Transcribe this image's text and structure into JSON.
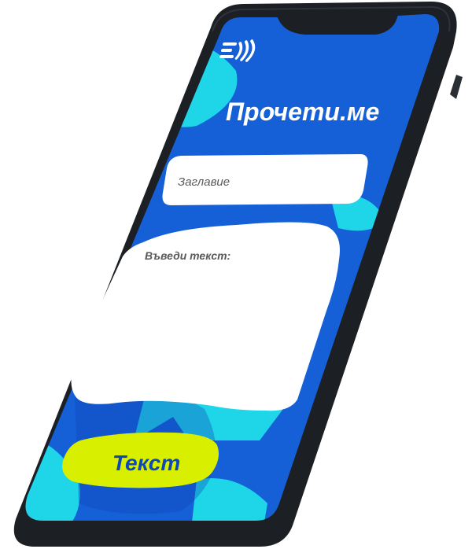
{
  "app": {
    "title": "Прочети.ме"
  },
  "title_field": {
    "placeholder": "Заглавие"
  },
  "text_field": {
    "placeholder": "Въведи текст:"
  },
  "action_button": {
    "label": "Текст"
  },
  "colors": {
    "device_frame": "#1c1f24",
    "screen_bg": "#1560d6",
    "accent_cyan": "#1fd6e8",
    "button_lime": "#d8f000",
    "field_bg": "#ffffff",
    "field_text": "#595959",
    "button_text": "#1046b8"
  },
  "icons": {
    "logo": "speaker-waves-icon"
  }
}
